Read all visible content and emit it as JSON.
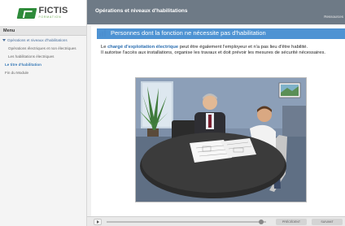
{
  "logo": {
    "brand": "FICTIS",
    "tagline": "FORMATION"
  },
  "menu": {
    "header": "Menu",
    "items": [
      {
        "label": "Opérations et niveaux d'habilitations",
        "level": 1,
        "expanded": true
      },
      {
        "label": "Opérations électriques et non électriques",
        "level": 2
      },
      {
        "label": "Les habilitations électriques",
        "level": 2
      },
      {
        "label": "Le titre d'habilitation",
        "level": 2,
        "active": true
      },
      {
        "label": "Fin du Module",
        "level": 2
      }
    ]
  },
  "topbar": {
    "title": "Opérations et niveaux d'habilitations",
    "resources_link": "Ressources"
  },
  "slide": {
    "heading": "Personnes dont la fonction ne nécessite pas d'habilitation",
    "para1_before": "Le ",
    "para1_highlight": "chargé d'exploitation électrique",
    "para1_after": " peut être également l'employeur et n'a pas lieu d'être habilité.",
    "para2": "Il autorise l'accès aux installations, organise les travaux et doit prévoir les mesures de sécurité nécessaires."
  },
  "player": {
    "prev_label": "PRÉCÉDENT",
    "next_label": "SUIVANT",
    "progress": 0.97
  },
  "colors": {
    "brand_green": "#2e8b3a",
    "heading_blue": "#4e93d3",
    "highlight_blue": "#2a6db0",
    "topbar": "#6e7a86"
  }
}
